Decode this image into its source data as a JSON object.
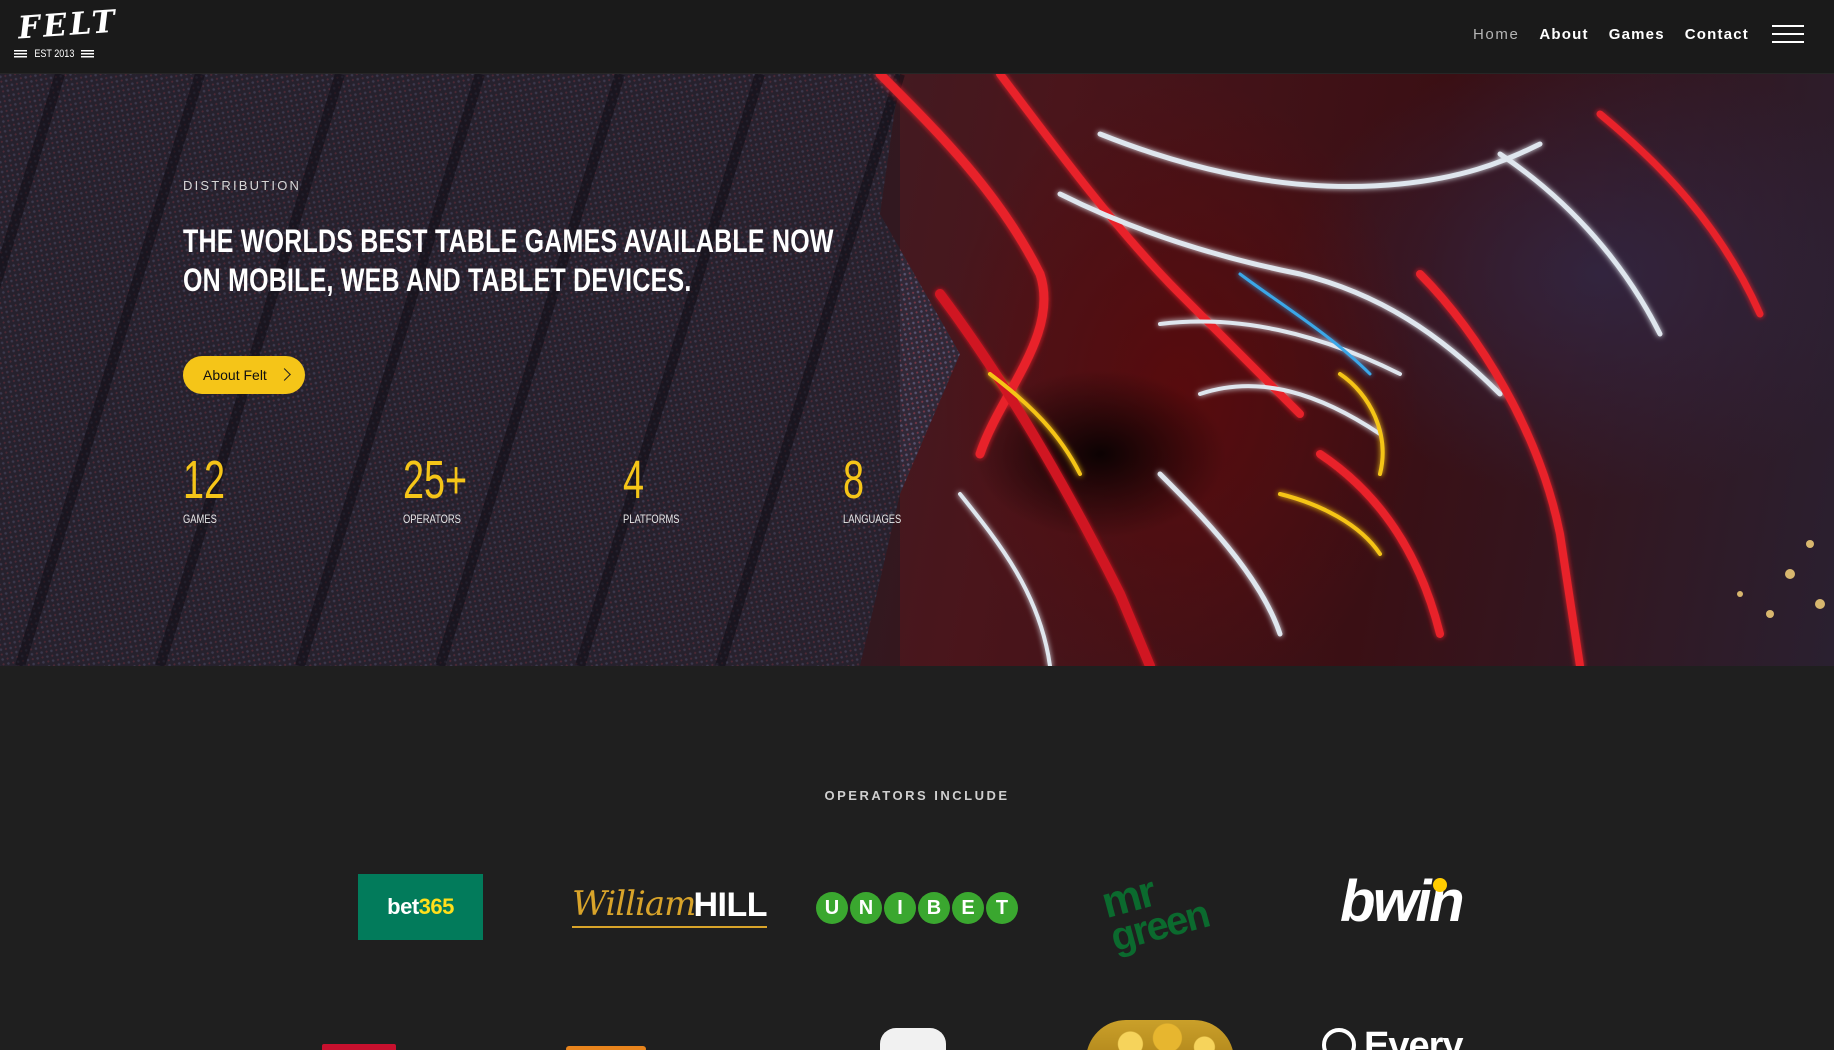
{
  "header": {
    "logo": {
      "word": "FELT",
      "est": "EST 2013"
    },
    "nav": [
      {
        "label": "Home",
        "active": true
      },
      {
        "label": "About",
        "active": false
      },
      {
        "label": "Games",
        "active": false
      },
      {
        "label": "Contact",
        "active": false
      }
    ],
    "menu_icon": "hamburger-icon"
  },
  "hero": {
    "kicker": "DISTRIBUTION",
    "headline": "THE WORLDS BEST TABLE GAMES AVAILABLE NOW ON MOBILE, WEB AND TABLET DEVICES.",
    "cta_label": "About Felt",
    "cta_icon": "chevron-right-icon",
    "stats": [
      {
        "value": "12",
        "label": "GAMES"
      },
      {
        "value": "25+",
        "label": "OPERATORS"
      },
      {
        "value": "4",
        "label": "PLATFORMS"
      },
      {
        "value": "8",
        "label": "LANGUAGES"
      }
    ]
  },
  "operators": {
    "title": "OPERATORS INCLUDE",
    "logos": {
      "bet365": {
        "part1": "bet",
        "part2": "365"
      },
      "william_hill": {
        "script": "William",
        "block": "HILL"
      },
      "unibet": [
        "U",
        "N",
        "I",
        "B",
        "E",
        "T"
      ],
      "mr_green": {
        "line1": "mr",
        "line2": "green"
      },
      "bwin": "bwin",
      "every": "Every"
    }
  },
  "colors": {
    "accent_yellow": "#f5c518",
    "header_bg": "#1a1a1a",
    "section_bg": "#1f1f1f",
    "bet365_green": "#027b5b",
    "unibet_green": "#3aa72f",
    "mrgreen_green": "#0b6a2e",
    "william_hill_gold": "#d9a42a"
  }
}
